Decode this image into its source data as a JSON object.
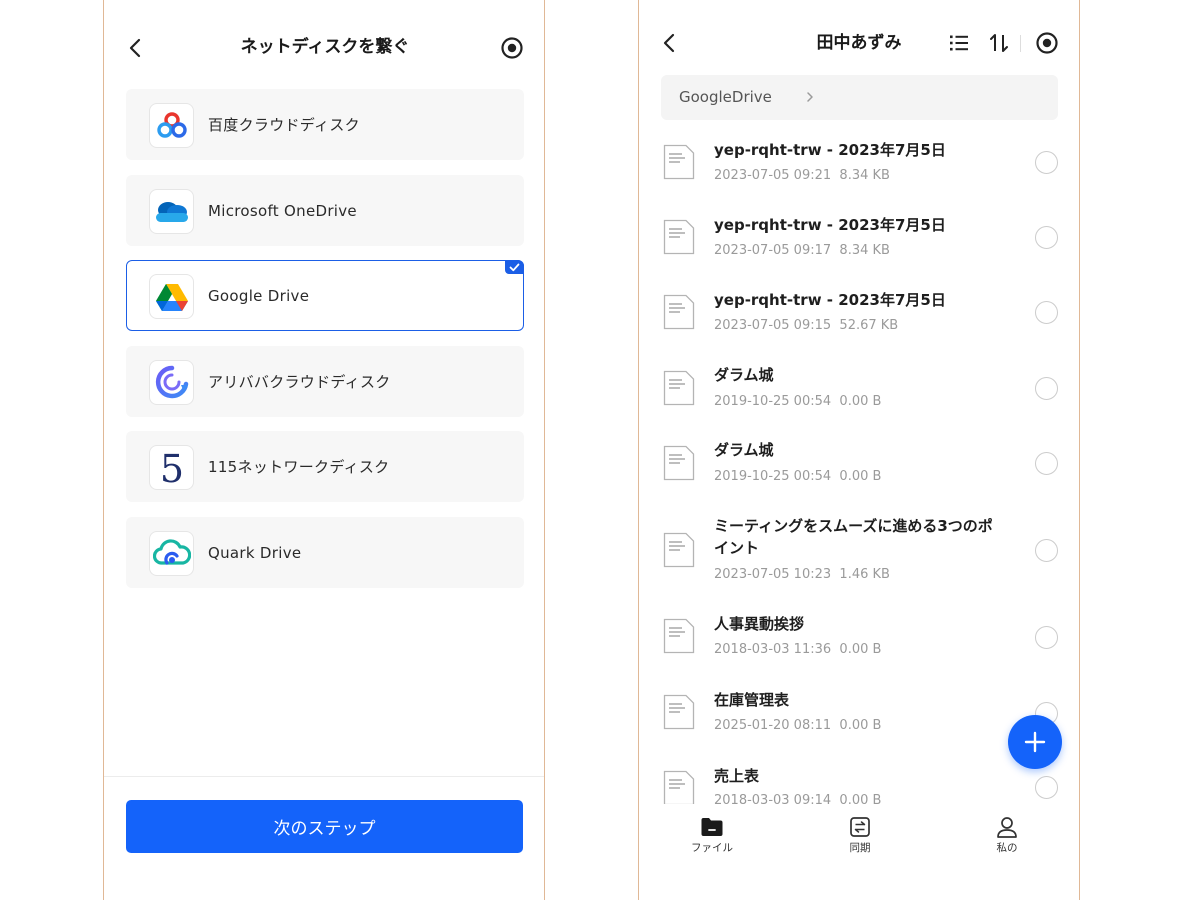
{
  "left": {
    "title": "ネットディスクを繋ぐ",
    "disks": [
      {
        "name": "百度クラウドディスク",
        "logo": "baidu-cloud-logo",
        "selected": false
      },
      {
        "name": "Microsoft OneDrive",
        "logo": "onedrive-logo",
        "selected": false
      },
      {
        "name": "Google Drive",
        "logo": "google-drive-logo",
        "selected": true
      },
      {
        "name": "アリババクラウドディスク",
        "logo": "alibaba-cloud-logo",
        "selected": false
      },
      {
        "name": "115ネットワークディスク",
        "logo": "115-logo",
        "selected": false
      },
      {
        "name": "Quark Drive",
        "logo": "quark-drive-logo",
        "selected": false
      }
    ],
    "next_button": "次のステップ"
  },
  "right": {
    "title": "田中あずみ",
    "breadcrumb": "GoogleDrive",
    "files": [
      {
        "name": "yep-rqht-trw - 2023年7月5日",
        "date": "2023-07-05 09:21",
        "size": "8.34 KB"
      },
      {
        "name": "yep-rqht-trw - 2023年7月5日",
        "date": "2023-07-05 09:17",
        "size": "8.34 KB"
      },
      {
        "name": "yep-rqht-trw - 2023年7月5日",
        "date": "2023-07-05 09:15",
        "size": "52.67 KB"
      },
      {
        "name": "ダラム城",
        "date": "2019-10-25 00:54",
        "size": "0.00 B"
      },
      {
        "name": "ダラム城",
        "date": "2019-10-25 00:54",
        "size": "0.00 B"
      },
      {
        "name": "ミーティングをスムーズに進める3つのポイント",
        "date": "2023-07-05 10:23",
        "size": "1.46 KB"
      },
      {
        "name": "人事異動挨拶",
        "date": "2018-03-03 11:36",
        "size": "0.00 B"
      },
      {
        "name": "在庫管理表",
        "date": "2025-01-20 08:11",
        "size": "0.00 B"
      },
      {
        "name": "売上表",
        "date": "2018-03-03 09:14",
        "size": "0.00 B"
      }
    ],
    "nav": [
      {
        "label": "ファイル",
        "icon": "folder-icon",
        "active": true
      },
      {
        "label": "同期",
        "icon": "sync-icon",
        "active": false
      },
      {
        "label": "私の",
        "icon": "person-icon",
        "active": false
      }
    ]
  },
  "colors": {
    "accent": "#1463fa",
    "selected_border": "#1b5ee6",
    "meta_text": "#9a9a9a"
  }
}
